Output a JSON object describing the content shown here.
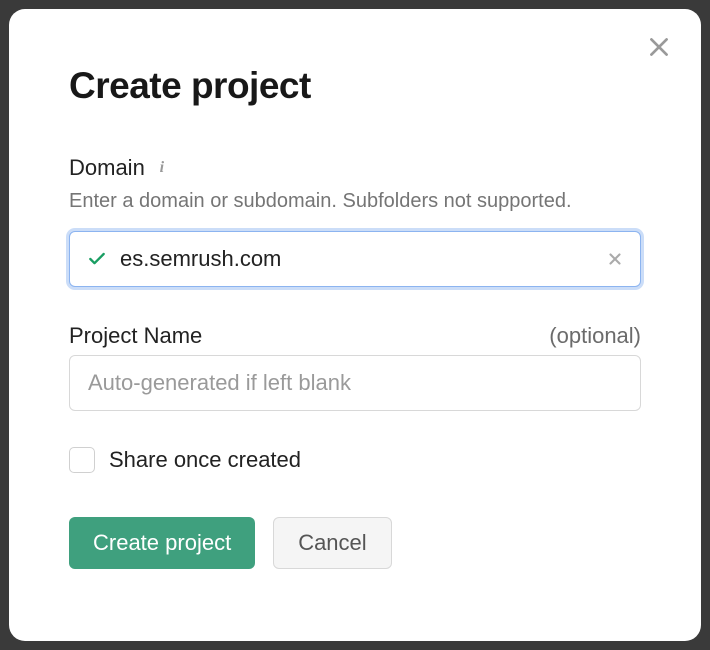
{
  "modal": {
    "title": "Create project",
    "domain": {
      "label": "Domain",
      "help": "Enter a domain or subdomain. Subfolders not supported.",
      "value": "es.semrush.com"
    },
    "projectName": {
      "label": "Project Name",
      "optional": "(optional)",
      "placeholder": "Auto-generated if left blank",
      "value": ""
    },
    "share": {
      "label": "Share once created",
      "checked": false
    },
    "actions": {
      "primary": "Create project",
      "secondary": "Cancel"
    }
  }
}
